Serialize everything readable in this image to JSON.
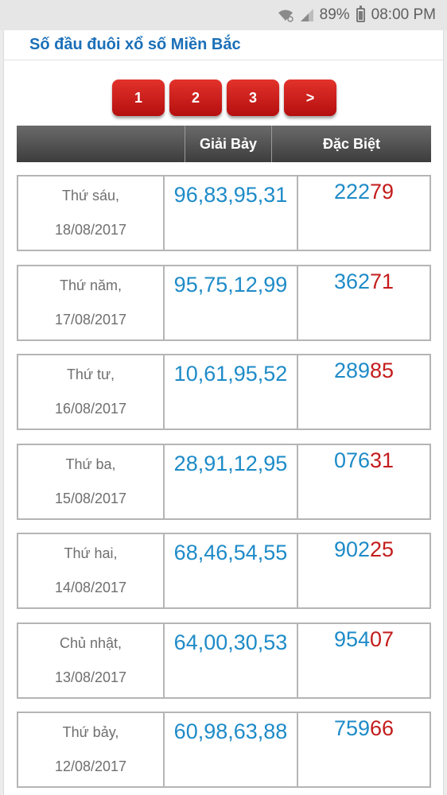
{
  "status": {
    "battery": "89%",
    "time": "08:00 PM"
  },
  "title": "Số đầu đuôi xổ số Miền Bắc",
  "pager": [
    "1",
    "2",
    "3",
    ">"
  ],
  "table": {
    "headers": [
      "",
      "Giải Bảy",
      "Đặc Biệt"
    ],
    "rows": [
      {
        "day": "Thứ sáu,",
        "date": "18/08/2017",
        "seven": "96,83,95,31",
        "special_head": "222",
        "special_tail": "79"
      },
      {
        "day": "Thứ năm,",
        "date": "17/08/2017",
        "seven": "95,75,12,99",
        "special_head": "362",
        "special_tail": "71"
      },
      {
        "day": "Thứ tư,",
        "date": "16/08/2017",
        "seven": "10,61,95,52",
        "special_head": "289",
        "special_tail": "85"
      },
      {
        "day": "Thứ ba,",
        "date": "15/08/2017",
        "seven": "28,91,12,95",
        "special_head": "076",
        "special_tail": "31"
      },
      {
        "day": "Thứ hai,",
        "date": "14/08/2017",
        "seven": "68,46,54,55",
        "special_head": "902",
        "special_tail": "25"
      },
      {
        "day": "Chủ nhật,",
        "date": "13/08/2017",
        "seven": "64,00,30,53",
        "special_head": "954",
        "special_tail": "07"
      },
      {
        "day": "Thứ bảy,",
        "date": "12/08/2017",
        "seven": "60,98,63,88",
        "special_head": "759",
        "special_tail": "66"
      }
    ]
  },
  "colors": {
    "accent_blue": "#1e8bc8",
    "accent_red": "#c41c1c",
    "button_red": "#d42020"
  }
}
